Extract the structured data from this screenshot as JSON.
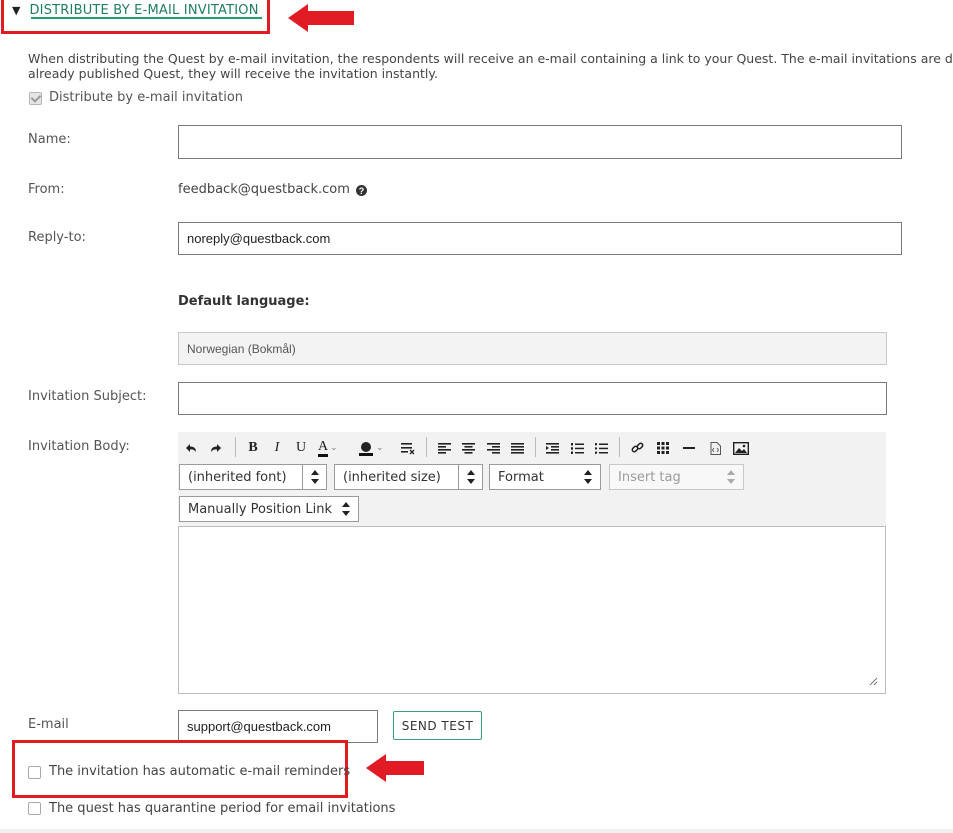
{
  "section": {
    "title": "DISTRIBUTE BY E-MAIL INVITATION",
    "description_line1": "When distributing the Quest by e-mail invitation, the respondents will receive an e-mail containing a link to your Quest. The e-mail invitations are d",
    "description_line2": "already published Quest, they will receive the invitation instantly.",
    "distribute_checkbox_label": "Distribute by e-mail invitation",
    "distribute_checked": true
  },
  "form": {
    "name_label": "Name:",
    "name_value": "",
    "from_label": "From:",
    "from_value": "feedback@questback.com",
    "help_glyph": "?",
    "reply_to_label": "Reply-to:",
    "reply_to_value": "noreply@questback.com",
    "default_language_label": "Default language:",
    "default_language_value": "Norwegian (Bokmål)",
    "invitation_subject_label": "Invitation Subject:",
    "invitation_subject_value": "",
    "invitation_body_label": "Invitation Body:",
    "email_label": "E-mail",
    "email_value": "support@questback.com",
    "send_test_label": "SEND TEST"
  },
  "editor": {
    "toolbar_buttons": [
      "undo-icon",
      "redo-icon",
      "bold",
      "italic",
      "underline",
      "font-color",
      "highlight-color",
      "clear-format",
      "align-left",
      "align-center",
      "align-right",
      "justify",
      "indent",
      "numbered-list",
      "bulleted-list",
      "link",
      "table",
      "horizontal-line",
      "source",
      "image"
    ],
    "bold_glyph": "B",
    "italic_glyph": "I",
    "underline_glyph": "U",
    "font_color_glyph": "A",
    "font_select": "(inherited font)",
    "size_select": "(inherited size)",
    "format_select": "Format",
    "insert_tag_select": "Insert tag",
    "link_position_select": "Manually Position Link",
    "body_text": ""
  },
  "options": {
    "reminders_label": "The invitation has automatic e-mail reminders",
    "reminders_checked": false,
    "quarantine_label": "The quest has quarantine period for email invitations",
    "quarantine_checked": false
  },
  "colors": {
    "annotation_red": "#e01b24",
    "header_underline": "#1fa36b",
    "header_text": "#1f7f5c"
  }
}
